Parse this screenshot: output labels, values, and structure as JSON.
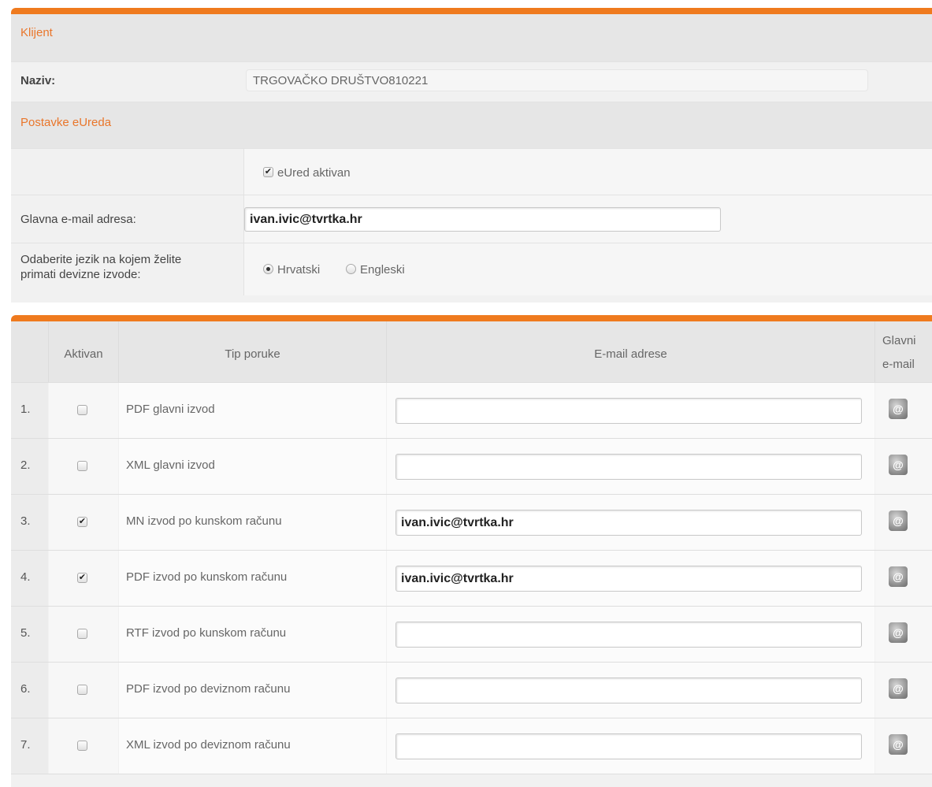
{
  "client_panel": {
    "section_title": "Klijent",
    "name_label": "Naziv:",
    "name_value": "TRGOVAČKO DRUŠTVO810221",
    "settings_title": "Postavke eUreda",
    "active_checkbox_label": "eUred aktivan",
    "active_checked": true,
    "email_label": "Glavna e-mail adresa:",
    "email_value": "ivan.ivic@tvrtka.hr",
    "lang_label_line1": "Odaberite jezik na kojem želite",
    "lang_label_line2": "primati devizne izvode:",
    "lang_options": [
      "Hrvatski",
      "Engleski"
    ],
    "lang_selected": "Hrvatski"
  },
  "table": {
    "headers": {
      "active": "Aktivan",
      "type": "Tip poruke",
      "emails": "E-mail adrese",
      "main_line1": "Glavni",
      "main_line2": "e-mail"
    },
    "rows": [
      {
        "num": "1.",
        "checked": false,
        "type": "PDF glavni izvod",
        "email": ""
      },
      {
        "num": "2.",
        "checked": false,
        "type": "XML glavni izvod",
        "email": ""
      },
      {
        "num": "3.",
        "checked": true,
        "type": "MN izvod po kunskom računu",
        "email": "ivan.ivic@tvrtka.hr"
      },
      {
        "num": "4.",
        "checked": true,
        "type": "PDF izvod po kunskom računu",
        "email": "ivan.ivic@tvrtka.hr"
      },
      {
        "num": "5.",
        "checked": false,
        "type": "RTF izvod po kunskom računu",
        "email": ""
      },
      {
        "num": "6.",
        "checked": false,
        "type": "PDF izvod po deviznom računu",
        "email": ""
      },
      {
        "num": "7.",
        "checked": false,
        "type": "XML izvod po deviznom računu",
        "email": ""
      }
    ],
    "main_email_icon": "at-mail-icon"
  },
  "colors": {
    "accent": "#ef7a1e",
    "section_text": "#e9762b"
  }
}
